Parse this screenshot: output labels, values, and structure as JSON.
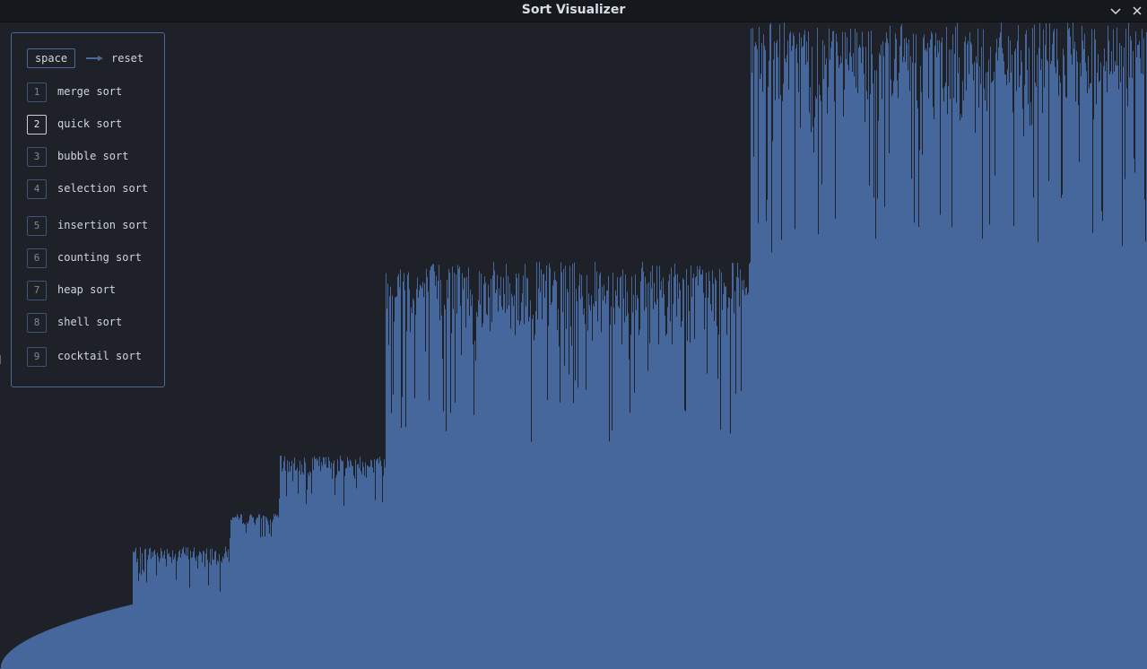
{
  "window": {
    "title": "Sort Visualizer",
    "controls": [
      "chevron-down-icon",
      "close-icon"
    ]
  },
  "colors": {
    "background": "#1e2127",
    "bar": "#46679c",
    "panel_border": "#4b6a9b",
    "titlebar": "#15181d"
  },
  "legend": {
    "reset_key": "space",
    "reset_label": "reset",
    "items": [
      {
        "key": "1",
        "label": "merge sort",
        "active": false
      },
      {
        "key": "2",
        "label": "quick sort",
        "active": true
      },
      {
        "key": "3",
        "label": "bubble sort",
        "active": false
      },
      {
        "key": "4",
        "label": "selection sort",
        "active": false
      },
      {
        "key": "5",
        "label": "insertion sort",
        "active": false
      },
      {
        "key": "6",
        "label": "counting sort",
        "active": false
      },
      {
        "key": "7",
        "label": "heap sort",
        "active": false
      },
      {
        "key": "8",
        "label": "shell sort",
        "active": false
      },
      {
        "key": "9",
        "label": "cocktail sort",
        "active": false
      }
    ]
  },
  "visualization": {
    "type": "bar",
    "description_state": "quick sort in progress",
    "value_range": [
      0,
      100
    ],
    "partitions": [
      {
        "from": 0.0,
        "to": 0.115,
        "min": 0,
        "max": 10,
        "spread": 0.0
      },
      {
        "from": 0.115,
        "to": 0.2,
        "min": 12,
        "max": 19,
        "spread": 1
      },
      {
        "from": 0.2,
        "to": 0.243,
        "min": 20,
        "max": 24,
        "spread": 1
      },
      {
        "from": 0.243,
        "to": 0.336,
        "min": 25,
        "max": 33,
        "spread": 1
      },
      {
        "from": 0.336,
        "to": 0.654,
        "min": 34,
        "max": 63,
        "spread": 1
      },
      {
        "from": 0.654,
        "to": 1.0,
        "min": 64,
        "max": 100,
        "spread": 1
      }
    ]
  }
}
